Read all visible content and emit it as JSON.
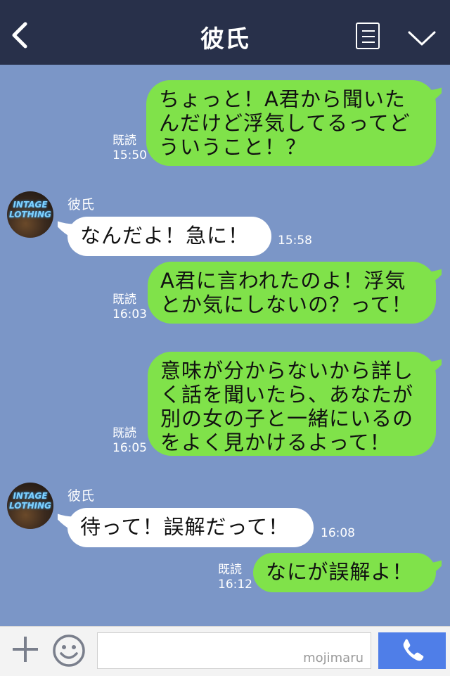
{
  "header": {
    "title": "彼氏"
  },
  "messages": [
    {
      "dir": "out",
      "read": "既読",
      "time": "15:50",
      "lines": [
        "ちょっと！A君から聞いた",
        "んだけど浮気してるってど",
        "ういうこと！？"
      ]
    },
    {
      "dir": "in",
      "sender": "彼氏",
      "time": "15:58",
      "lines": [
        "なんだよ！急に！"
      ]
    },
    {
      "dir": "out",
      "read": "既読",
      "time": "16:03",
      "lines": [
        "A君に言われたのよ！浮気",
        "とか気にしないの？って！"
      ]
    },
    {
      "dir": "out",
      "read": "既読",
      "time": "16:05",
      "lines": [
        "意味が分からないから詳し",
        "く話を聞いたら、あなたが",
        "別の女の子と一緒にいるの",
        "をよく見かけるよって！"
      ]
    },
    {
      "dir": "in",
      "sender": "彼氏",
      "time": "16:08",
      "lines": [
        "待って！誤解だって！"
      ]
    },
    {
      "dir": "out",
      "read": "既読",
      "time": "16:12",
      "lines": [
        "なにが誤解よ！"
      ]
    }
  ],
  "avatar": {
    "text_line1": "INTAGE",
    "text_line2": "LOTHING"
  },
  "footer": {
    "watermark": "mojimaru"
  },
  "colors": {
    "header": "#28304a",
    "chat_bg": "#7b96c7",
    "outgoing": "#80e24a",
    "incoming": "#ffffff",
    "call": "#4f7ee8"
  }
}
